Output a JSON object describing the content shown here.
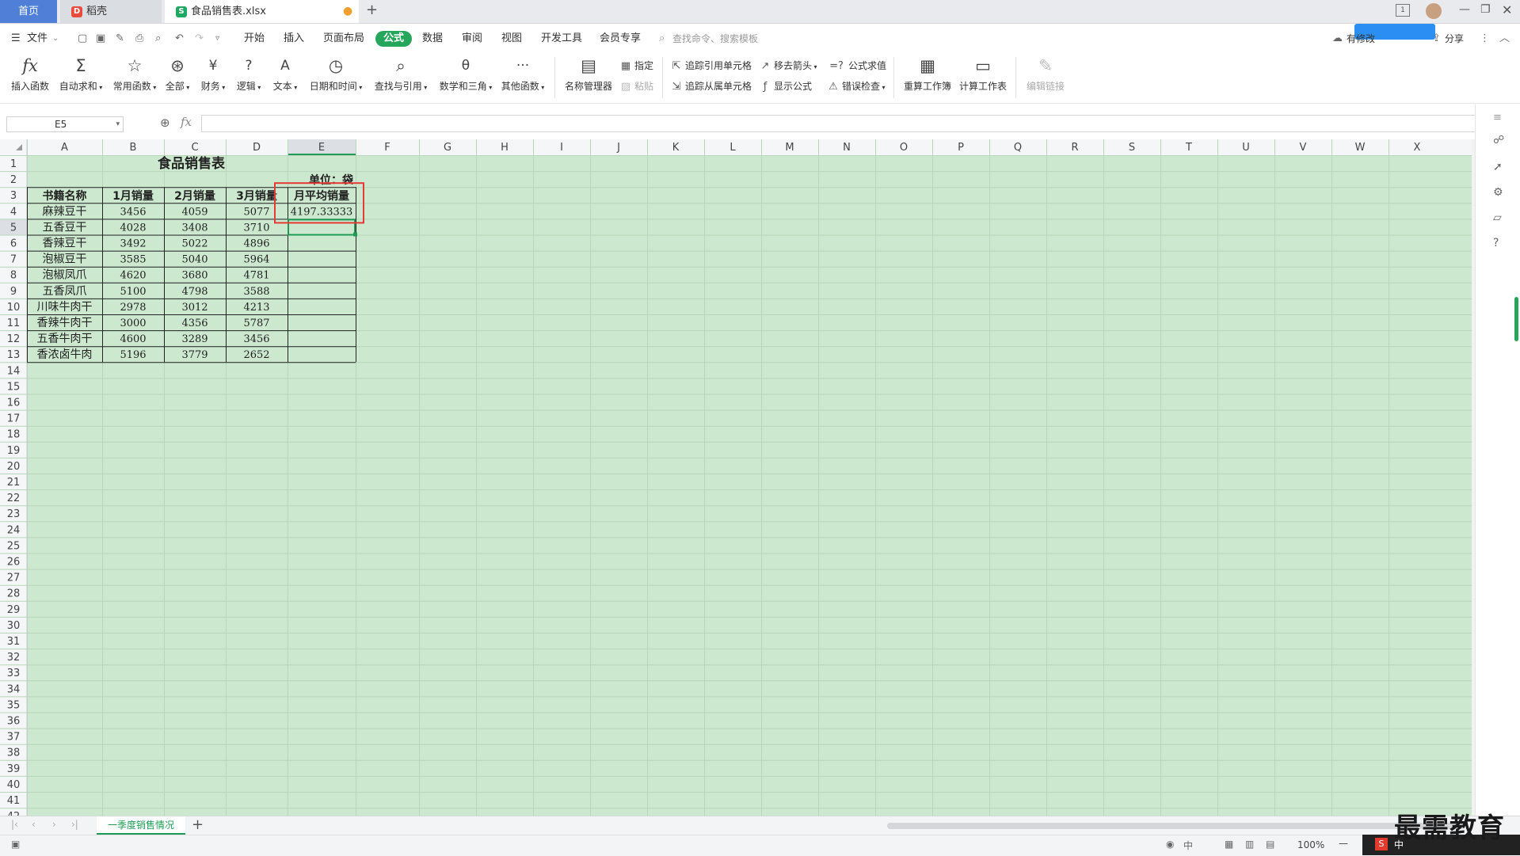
{
  "tabs": {
    "home": "首页",
    "daoke": "稻壳",
    "file": "食品销售表.xlsx",
    "add": "+"
  },
  "menu": {
    "file": "文件",
    "items": [
      "开始",
      "插入",
      "页面布局",
      "公式",
      "数据",
      "审阅",
      "视图",
      "开发工具",
      "会员专享"
    ],
    "search": "查找命令、搜索模板",
    "collab": "有修改",
    "share": "分享"
  },
  "ribbon": {
    "insert_func": "插入函数",
    "autosum": "自动求和",
    "common": "常用函数",
    "all": "全部",
    "finance": "财务",
    "logic": "逻辑",
    "text": "文本",
    "datetime": "日期和时间",
    "lookup": "查找与引用",
    "math": "数学和三角",
    "other": "其他函数",
    "name_mgr": "名称管理器",
    "specify": "指定",
    "paste": "粘贴",
    "trace_prec": "追踪引用单元格",
    "trace_dep": "追踪从属单元格",
    "remove_arrows": "移去箭头",
    "show_formula": "显示公式",
    "eval_formula": "公式求值",
    "error_check": "错误检查",
    "recalc_book": "重算工作簿",
    "calc_sheet": "计算工作表",
    "edit_links": "编辑链接"
  },
  "formula_bar": {
    "cell_ref": "E5",
    "fx": "fx",
    "value": ""
  },
  "columns": [
    "A",
    "B",
    "C",
    "D",
    "E",
    "F",
    "G",
    "H",
    "I",
    "J",
    "K",
    "L",
    "M",
    "N",
    "O",
    "P",
    "Q",
    "R",
    "S",
    "T",
    "U",
    "V",
    "W",
    "X"
  ],
  "sheet": {
    "title": "食品销售表",
    "unit": "单位：袋",
    "headers": [
      "书籍名称",
      "1月销量",
      "2月销量",
      "3月销量",
      "月平均销量"
    ],
    "rows": [
      [
        "麻辣豆干",
        "3456",
        "4059",
        "5077",
        "4197.33333"
      ],
      [
        "五香豆干",
        "4028",
        "3408",
        "3710",
        ""
      ],
      [
        "香辣豆干",
        "3492",
        "5022",
        "4896",
        ""
      ],
      [
        "泡椒豆干",
        "3585",
        "5040",
        "5964",
        ""
      ],
      [
        "泡椒凤爪",
        "4620",
        "3680",
        "4781",
        ""
      ],
      [
        "五香凤爪",
        "5100",
        "4798",
        "3588",
        ""
      ],
      [
        "川味牛肉干",
        "2978",
        "3012",
        "4213",
        ""
      ],
      [
        "香辣牛肉干",
        "3000",
        "4356",
        "5787",
        ""
      ],
      [
        "五香牛肉干",
        "4600",
        "3289",
        "3456",
        ""
      ],
      [
        "香浓卤牛肉",
        "5196",
        "3779",
        "2652",
        ""
      ]
    ]
  },
  "sheet_tab": "一季度销售情况",
  "status": {
    "zoom": "100%",
    "ime": "中"
  },
  "watermark": "最需教育"
}
